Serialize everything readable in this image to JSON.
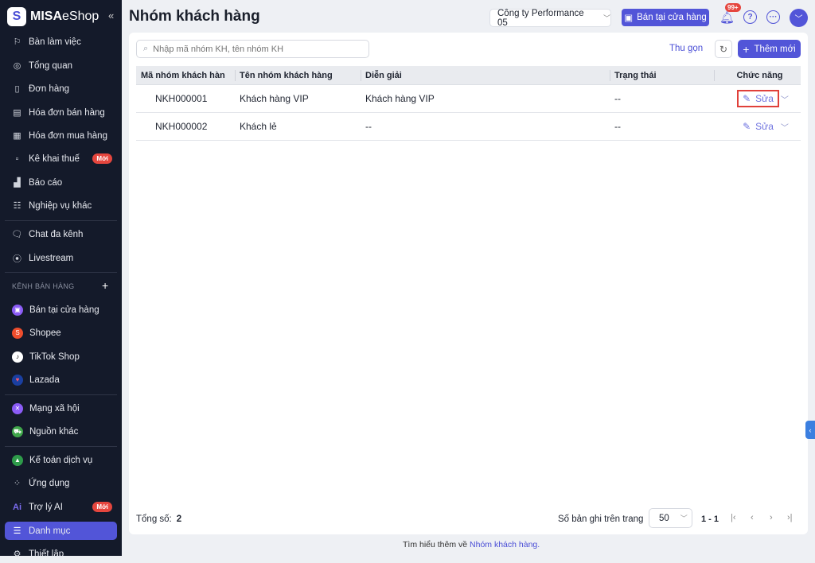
{
  "sidebar": {
    "logo_bold": "MISA",
    "logo_light": "eShop",
    "items": [
      {
        "label": "Bàn làm việc",
        "icon": "desk-icon"
      },
      {
        "label": "Tổng quan",
        "icon": "gauge-icon"
      },
      {
        "label": "Đơn hàng",
        "icon": "order-icon"
      },
      {
        "label": "Hóa đơn bán hàng",
        "icon": "invoice-icon"
      },
      {
        "label": "Hóa đơn mua hàng",
        "icon": "purchase-invoice-icon"
      },
      {
        "label": "Kê khai thuế",
        "icon": "tax-icon",
        "badge": "Mới"
      },
      {
        "label": "Báo cáo",
        "icon": "report-icon"
      },
      {
        "label": "Nghiệp vụ khác",
        "icon": "list-icon"
      },
      {
        "label": "Chat đa kênh",
        "icon": "chat-icon"
      },
      {
        "label": "Livestream",
        "icon": "livestream-icon"
      }
    ],
    "section_title": "KÊNH BÁN HÀNG",
    "channels": [
      {
        "label": "Bán tại cửa hàng",
        "color": "#8b5cf6"
      },
      {
        "label": "Shopee",
        "color": "#ee4d2d"
      },
      {
        "label": "TikTok Shop",
        "color": "#ffffff"
      },
      {
        "label": "Lazada",
        "color": "#1a3fa0"
      },
      {
        "label": "Mạng xã hội",
        "color": "#8b5cf6"
      },
      {
        "label": "Nguồn khác",
        "color": "#3fa64a"
      },
      {
        "label": "Kế toán dịch vụ",
        "color": "#2e9b4a"
      }
    ],
    "bottom": [
      {
        "label": "Ứng dụng"
      },
      {
        "label": "Trợ lý AI",
        "badge": "Mới"
      },
      {
        "label": "Danh mục"
      },
      {
        "label": "Thiết lập"
      }
    ]
  },
  "header": {
    "title": "Nhóm khách hàng",
    "company": "Công ty Performance 05",
    "store_button": "Bán tại cửa hàng",
    "notif_count": "99+"
  },
  "toolbar": {
    "search_placeholder": "Nhập mã nhóm KH, tên nhóm KH",
    "collapse": "Thu gọn",
    "add": "Thêm mới"
  },
  "table": {
    "headers": [
      "Mã nhóm khách hàn",
      "Tên nhóm khách hàng",
      "Diễn giải",
      "Trạng thái",
      "Chức năng"
    ],
    "rows": [
      {
        "code": "NKH000001",
        "name": "Khách hàng VIP",
        "desc": "Khách hàng VIP",
        "status": "--",
        "action": "Sửa"
      },
      {
        "code": "NKH000002",
        "name": "Khách lẻ",
        "desc": "--",
        "status": "--",
        "action": "Sửa"
      }
    ]
  },
  "pagination": {
    "total_label": "Tổng số:",
    "total": "2",
    "per_page_label": "Số bản ghi trên trang",
    "per_page": "50",
    "range": "1 - 1"
  },
  "footer": {
    "text": "Tìm hiểu thêm về",
    "link": "Nhóm khách hàng."
  }
}
